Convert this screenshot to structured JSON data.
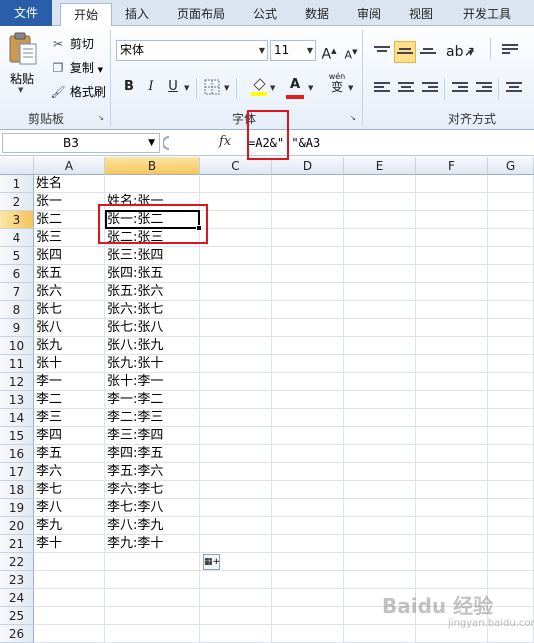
{
  "ribbon": {
    "tabs": [
      "文件",
      "开始",
      "插入",
      "页面布局",
      "公式",
      "数据",
      "审阅",
      "视图",
      "开发工具"
    ],
    "clipboard": {
      "paste": "粘贴",
      "cut": "剪切",
      "copy": "复制",
      "format_painter": "格式刷",
      "group_label": "剪贴板"
    },
    "font": {
      "name": "宋体",
      "size": "11",
      "grow": "A",
      "shrink": "A",
      "bold": "B",
      "italic": "I",
      "underline": "U",
      "font_color": "A",
      "phonetic": "wén",
      "group_label": "字体"
    },
    "alignment": {
      "group_label": "对齐方式"
    }
  },
  "formula_bar": {
    "name_box": "B3",
    "fx": "fx",
    "formula": "=A2&\":\"&A3"
  },
  "columns": [
    "A",
    "B",
    "C",
    "D",
    "E",
    "F",
    "G"
  ],
  "selected_column": "B",
  "selected_row": 3,
  "rows": [
    "1",
    "2",
    "3",
    "4",
    "5",
    "6",
    "7",
    "8",
    "9",
    "10",
    "11",
    "12",
    "13",
    "14",
    "15",
    "16",
    "17",
    "18",
    "19",
    "20",
    "21",
    "22",
    "23",
    "24",
    "25",
    "26"
  ],
  "col_a": [
    "姓名",
    "张一",
    "张二",
    "张三",
    "张四",
    "张五",
    "张六",
    "张七",
    "张八",
    "张九",
    "张十",
    "李一",
    "李二",
    "李三",
    "李四",
    "李五",
    "李六",
    "李七",
    "李八",
    "李九",
    "李十"
  ],
  "col_b": [
    "",
    "姓名:张一",
    "张一:张二",
    "张二:张三",
    "张三:张四",
    "张四:张五",
    "张五:张六",
    "张六:张七",
    "张七:张八",
    "张八:张九",
    "张九:张十",
    "张十:李一",
    "李一:李二",
    "李二:李三",
    "李三:李四",
    "李四:李五",
    "李五:李六",
    "李六:李七",
    "李七:李八",
    "李八:李九",
    "李九:李十"
  ],
  "watermark": "Baidu 经验",
  "watermark_sub": "jingyan.baidu.com"
}
